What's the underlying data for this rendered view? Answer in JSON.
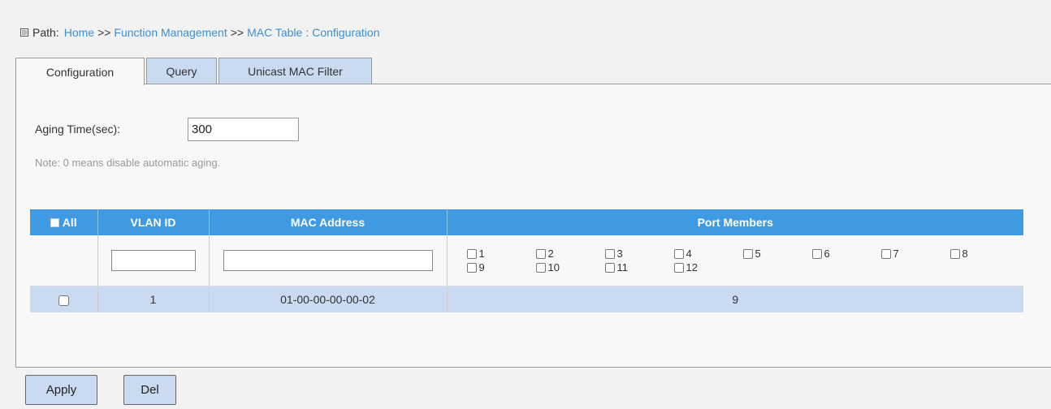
{
  "path": {
    "label": "Path:",
    "crumbs": [
      "Home",
      "Function Management",
      "MAC Table"
    ],
    "separator": ">>",
    "colon": ":",
    "current": "Configuration"
  },
  "tabs": [
    {
      "label": "Configuration",
      "active": true
    },
    {
      "label": "Query",
      "active": false
    },
    {
      "label": "Unicast MAC Filter",
      "active": false
    }
  ],
  "aging": {
    "label": "Aging Time(sec):",
    "value": "300",
    "note": "Note: 0 means disable automatic aging."
  },
  "table": {
    "headers": {
      "all": "All",
      "vlan": "VLAN ID",
      "mac": "MAC Address",
      "ports": "Port Members"
    },
    "port_options": [
      "1",
      "2",
      "3",
      "4",
      "5",
      "6",
      "7",
      "8",
      "9",
      "10",
      "11",
      "12"
    ],
    "rows": [
      {
        "vlan": "1",
        "mac": "01-00-00-00-00-02",
        "ports": "9"
      }
    ]
  },
  "buttons": {
    "apply": "Apply",
    "del": "Del"
  },
  "colors": {
    "header_blue": "#3f9ae4",
    "tab_inactive": "#c9daf1",
    "link_blue": "#3b8fd6",
    "row_blue": "#c9daf1"
  }
}
